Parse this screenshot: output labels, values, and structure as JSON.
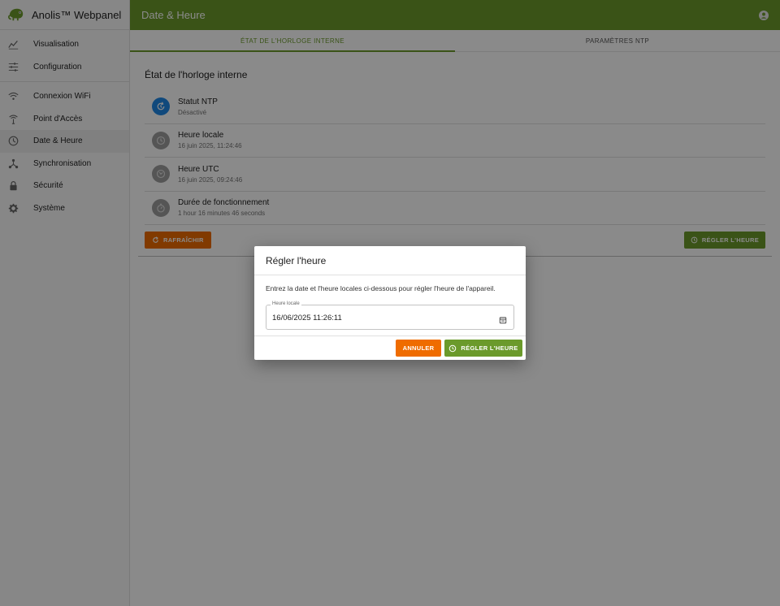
{
  "app": {
    "brand_name": "Anolis™ Webpanel",
    "page_title": "Date & Heure",
    "accent_color": "#6b9a2b",
    "warning_color": "#ef6c00"
  },
  "sidebar": {
    "items": [
      {
        "label": "Visualisation",
        "icon": "chart-icon"
      },
      {
        "label": "Configuration",
        "icon": "sliders-icon"
      },
      {
        "label": "Connexion WiFi",
        "icon": "wifi-icon"
      },
      {
        "label": "Point d'Accès",
        "icon": "access-point-icon"
      },
      {
        "label": "Date & Heure",
        "icon": "clock-icon",
        "active": true
      },
      {
        "label": "Synchronisation",
        "icon": "sync-icon"
      },
      {
        "label": "Sécurité",
        "icon": "lock-icon"
      },
      {
        "label": "Système",
        "icon": "gear-icon"
      }
    ]
  },
  "tabs": [
    {
      "label": "ÉTAT DE L'HORLOGE INTERNE",
      "active": true
    },
    {
      "label": "PARAMÈTRES NTP",
      "active": false
    }
  ],
  "clock_state": {
    "title": "État de l'horloge interne",
    "items": [
      {
        "label": "Statut NTP",
        "value": "Désactivé",
        "icon": "sync-clock-icon"
      },
      {
        "label": "Heure locale",
        "value": "16 juin 2025, 11:24:46",
        "icon": "clock-icon"
      },
      {
        "label": "Heure UTC",
        "value": "16 juin 2025, 09:24:46",
        "icon": "globe-clock-icon"
      },
      {
        "label": "Durée de fonctionnement",
        "value": "1 hour 16 minutes 46 seconds",
        "icon": "timer-icon"
      }
    ],
    "refresh_label": "RAFRAÎCHIR",
    "set_time_label": "RÉGLER L'HEURE"
  },
  "dialog": {
    "title": "Régler l'heure",
    "description": "Entrez la date et l'heure locales ci-dessous pour régler l'heure de l'appareil.",
    "field_label": "Heure locale",
    "field_value": "16/06/2025 11:26:11",
    "cancel_label": "ANNULER",
    "confirm_label": "RÉGLER L'HEURE"
  }
}
